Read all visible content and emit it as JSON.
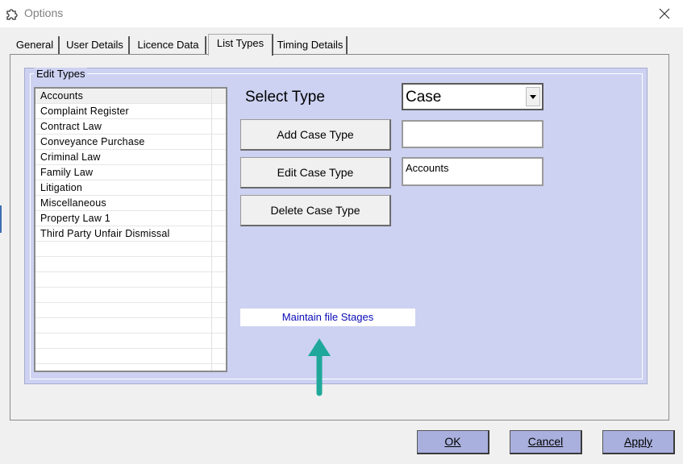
{
  "window": {
    "title": "Options",
    "icon": "puzzle-piece-icon",
    "close_icon": "close-icon"
  },
  "tabs": [
    {
      "label": "General"
    },
    {
      "label": "User Details"
    },
    {
      "label": "Licence Data"
    },
    {
      "label": "List Types"
    },
    {
      "label": "Timing Details"
    }
  ],
  "active_tab": "List Types",
  "edit_types": {
    "legend": "Edit Types",
    "items": [
      "Accounts",
      "Complaint Register",
      "Contract Law",
      "Conveyance Purchase",
      "Criminal Law",
      "Family Law",
      "Litigation",
      "Miscellaneous",
      "Property Law 1",
      "Third Party Unfair Dismissal"
    ],
    "selected": "Accounts",
    "select_type_label": "Select Type",
    "select_type_value": "Case",
    "add_button": "Add Case Type",
    "edit_button": "Edit Case Type",
    "delete_button": "Delete Case Type",
    "add_input_value": "",
    "edit_input_value": "Accounts",
    "maintain_link": "Maintain file Stages"
  },
  "dialog_buttons": {
    "ok": "OK",
    "cancel": "Cancel",
    "apply": "Apply"
  },
  "colors": {
    "panel": "#cdd2f2",
    "dialog_button": "#a9b0dd",
    "link": "#0a0ab8",
    "arrow": "#1fa89a"
  }
}
